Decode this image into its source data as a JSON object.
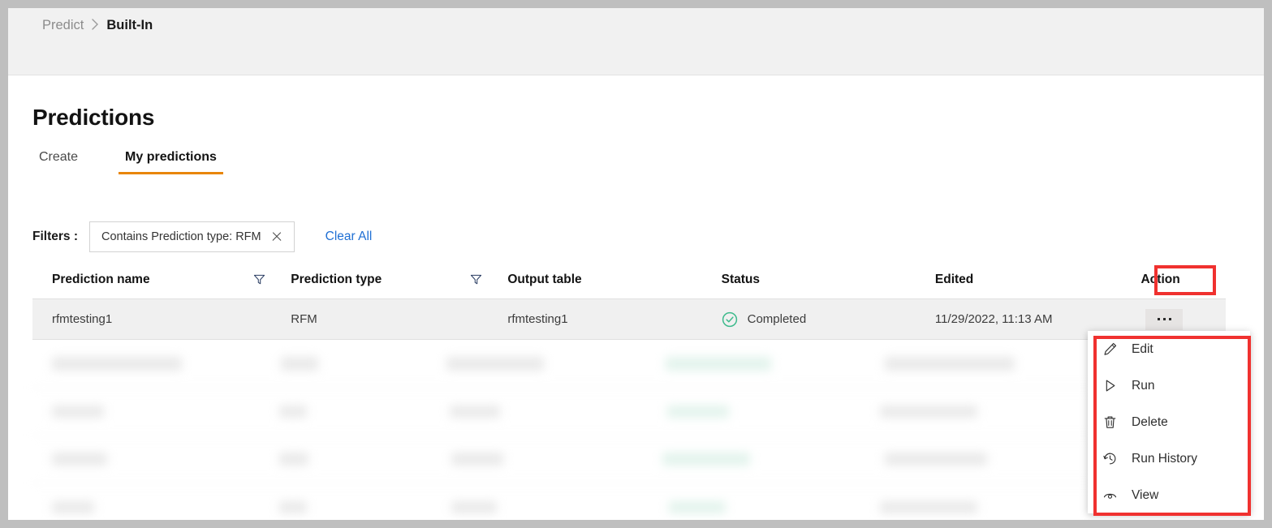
{
  "breadcrumb": {
    "parent": "Predict",
    "separator": "›",
    "current": "Built-In"
  },
  "page": {
    "title": "Predictions"
  },
  "tabs": [
    {
      "label": "Create",
      "active": false
    },
    {
      "label": "My predictions",
      "active": true
    }
  ],
  "filters": {
    "label": "Filters :",
    "chip": "Contains Prediction type: RFM",
    "chip_close_icon": "close-icon",
    "clear_all": "Clear All"
  },
  "table": {
    "columns": [
      {
        "key": "name",
        "label": "Prediction name",
        "has_filter_icon": true
      },
      {
        "key": "type",
        "label": "Prediction type",
        "has_filter_icon": true
      },
      {
        "key": "output",
        "label": "Output table",
        "has_filter_icon": false
      },
      {
        "key": "status",
        "label": "Status",
        "has_filter_icon": false
      },
      {
        "key": "edited",
        "label": "Edited",
        "has_filter_icon": false
      },
      {
        "key": "action",
        "label": "Action",
        "has_filter_icon": false
      }
    ],
    "rows": [
      {
        "name": "rfmtesting1",
        "type": "RFM",
        "output": "rfmtesting1",
        "status": "Completed",
        "status_icon": "check-circle-icon",
        "edited": "11/29/2022, 11:13 AM",
        "action_icon": "kebab-menu-icon",
        "selected": true
      }
    ],
    "redacted_row_count": 4
  },
  "action_menu": {
    "items": [
      {
        "label": "Edit",
        "icon": "pencil-icon"
      },
      {
        "label": "Run",
        "icon": "play-icon"
      },
      {
        "label": "Delete",
        "icon": "trash-icon"
      },
      {
        "label": "Run History",
        "icon": "history-clock-icon"
      },
      {
        "label": "View",
        "icon": "eye-icon"
      }
    ]
  },
  "colors": {
    "accent_tab": "#e8860a",
    "link": "#1f6fd4",
    "status_success": "#3dba8c",
    "annotation": "#f0312f",
    "header_band": "#f1f1f1",
    "selected_row": "#f0f0f0"
  }
}
